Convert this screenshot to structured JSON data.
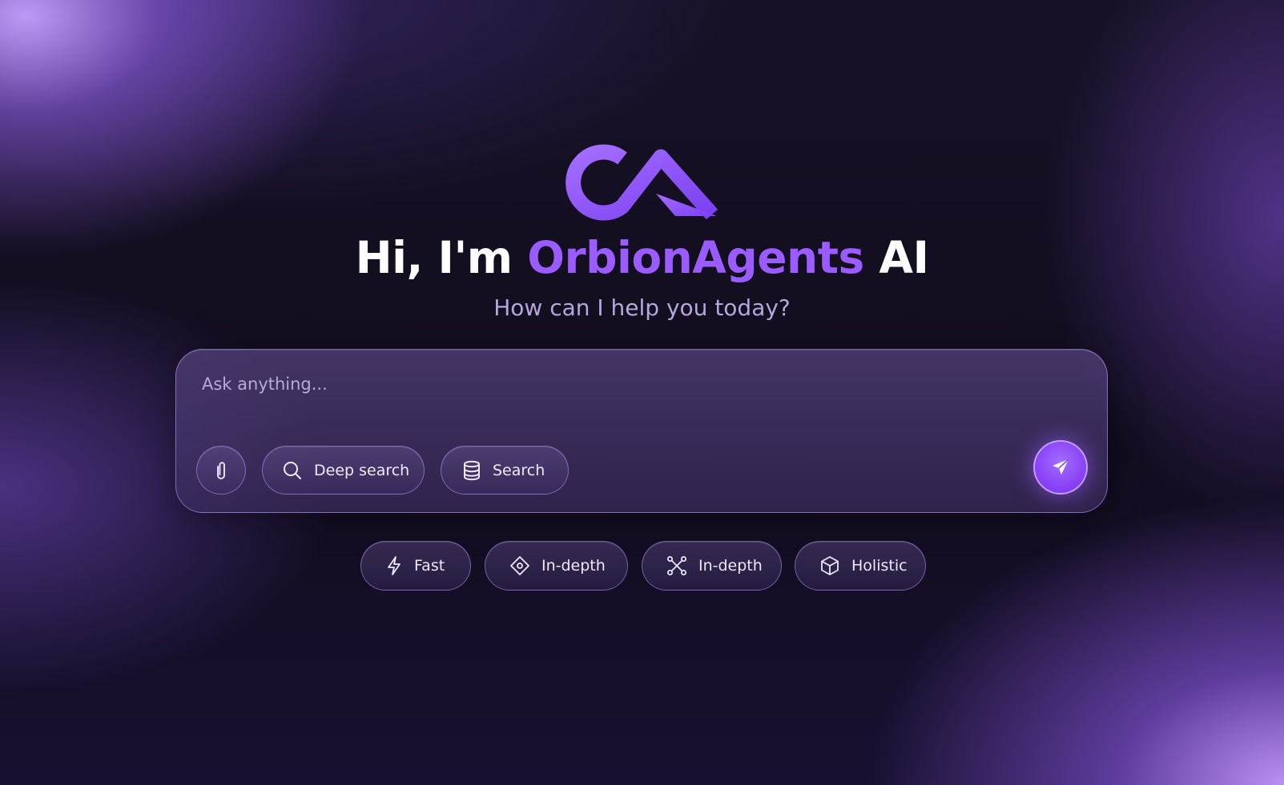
{
  "logo": {
    "icon": "orbionagents-logo-icon",
    "color": "#9a5cff"
  },
  "hero": {
    "greeting": "Hi, I'm ",
    "brand": "OrbionAgents",
    "suffix": " AI",
    "subtitle": "How can I help you today?"
  },
  "chat": {
    "placeholder": "Ask anything...",
    "value": "",
    "attach_icon": "paperclip-icon",
    "tools": [
      {
        "label": "Deep search",
        "icon": "search-icon"
      },
      {
        "label": "Search",
        "icon": "database-icon"
      }
    ],
    "send_icon": "send-icon"
  },
  "modes": [
    {
      "label": "Fast",
      "icon": "lightning-icon"
    },
    {
      "label": "In-depth",
      "icon": "diamond-target-icon"
    },
    {
      "label": "In-depth",
      "icon": "nodes-icon"
    },
    {
      "label": "Holistic",
      "icon": "cube-icon"
    }
  ],
  "colors": {
    "accent": "#9a5cff",
    "background": "#120d1f",
    "text": "#ffffff",
    "subtitle": "#b6a6dc"
  }
}
